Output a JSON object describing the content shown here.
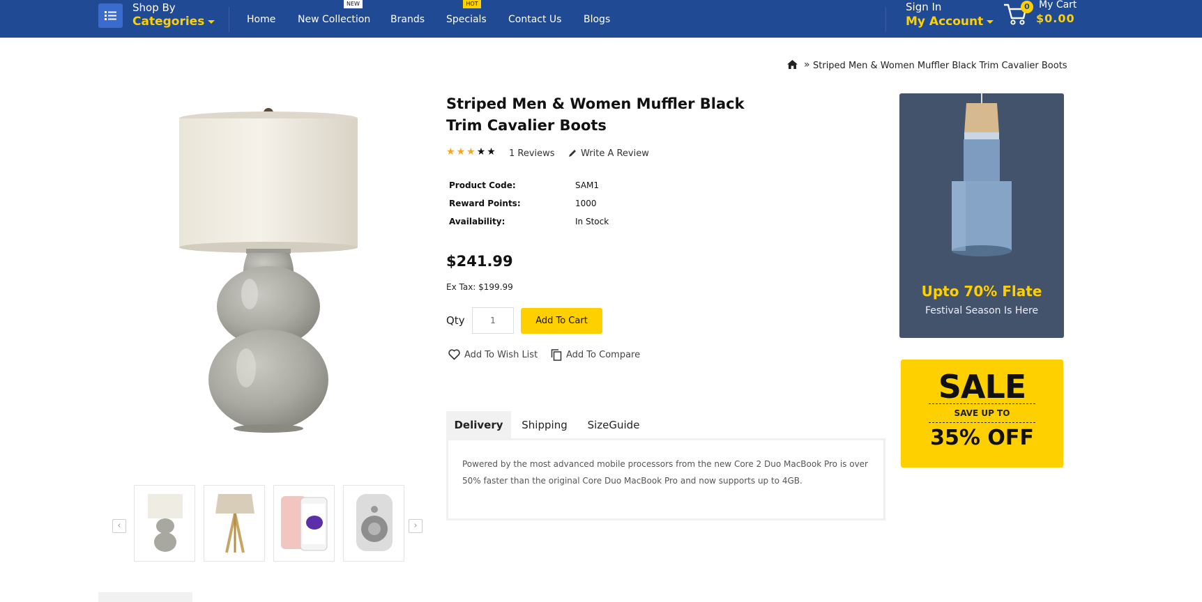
{
  "nav": {
    "shop_by": "Shop By",
    "categories": "Categories",
    "menu": [
      "Home",
      "New Collection",
      "Brands",
      "Specials",
      "Contact Us",
      "Blogs"
    ],
    "tag_new": "NEW",
    "tag_hot": "HOT",
    "sign_in": "Sign In",
    "my_account": "My Account",
    "cart_count": "0",
    "my_cart": "My Cart",
    "cart_total": "$0.00"
  },
  "breadcrumb": {
    "separator": "»",
    "current": "Striped Men & Women Muffler Black Trim Cavalier Boots"
  },
  "product": {
    "title": "Striped Men & Women Muffler Black Trim Cavalier Boots",
    "rating": 3,
    "rating_max": 5,
    "reviews": "1 Reviews",
    "write_review": "Write A Review",
    "specs": [
      {
        "label": "Product Code:",
        "value": "SAM1"
      },
      {
        "label": "Reward Points:",
        "value": "1000"
      },
      {
        "label": "Availability:",
        "value": "In Stock"
      }
    ],
    "price": "$241.99",
    "ex_tax": "Ex Tax: $199.99",
    "qty_label": "Qty",
    "qty_value": "1",
    "add_to_cart": "Add To Cart",
    "wish_list": "Add To Wish List",
    "compare": "Add To Compare"
  },
  "thumbnails": [
    "lamp-thumbnail",
    "tripod-lamp-thumbnail",
    "phone-thumbnail",
    "speaker-thumbnail"
  ],
  "tabs": {
    "items": [
      "Delivery",
      "Shipping",
      "SizeGuide"
    ],
    "active": "Delivery",
    "content": "Powered by the most advanced mobile processors from the new Core 2 Duo MacBook Pro is over 50% faster than the original Core Duo MacBook Pro and now supports up to 4GB."
  },
  "banners": {
    "promo_title": "Upto 70% Flate",
    "promo_sub": "Festival Season Is Here",
    "sale": "SALE",
    "save_up_to": "SAVE UP TO",
    "off": "35% OFF"
  },
  "colors": {
    "nav_bg": "#214a95",
    "accent": "#ffd000",
    "star": "#f5a623",
    "banner_bg": "#43536b"
  }
}
